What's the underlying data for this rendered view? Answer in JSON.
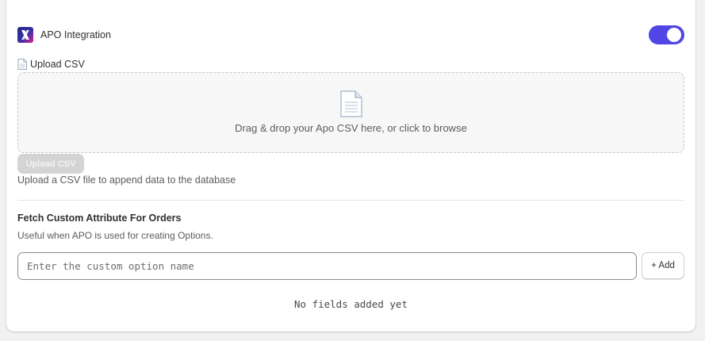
{
  "header": {
    "app_title": "APO Integration",
    "logo_icon": "apo-x-logo-icon",
    "toggle_on": true,
    "toggle_color": "#4f46e5"
  },
  "upload": {
    "section_label": "Upload CSV",
    "section_icon": "document-icon",
    "dropzone_text": "Drag & drop your Apo CSV here, or click to browse",
    "button_label": "Upload CSV",
    "help_text": "Upload a CSV file to append data to the database"
  },
  "custom_attributes": {
    "title": "Fetch Custom Attribute For Orders",
    "description": "Useful when APO is used for creating Options.",
    "input_placeholder": "Enter the custom option name",
    "input_value": "",
    "add_button_label": "+ Add",
    "empty_text": "No fields added yet"
  }
}
